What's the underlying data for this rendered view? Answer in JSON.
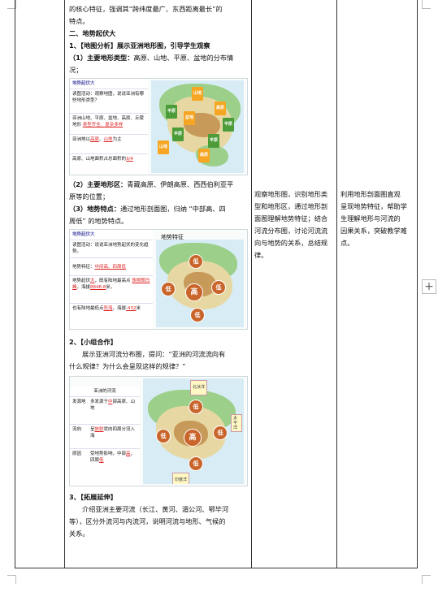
{
  "col2": {
    "l_intro1": "的核心特征，强调其“跨纬度最广、东西距离最长”的",
    "l_intro2": "特点。",
    "h2": "二、地势起伏大",
    "s1_title": "1、【地图分析】展示亚洲地形图，引导学生观察",
    "s1_sub1_b": "（1）主要地形类型：",
    "s1_sub1_t": "高原、山地、平原、盆地的分布情",
    "s1_sub1_t2": "况；",
    "fig1": {
      "head": "地势起伏大",
      "q": "读图活动：观察地图，说说亚洲有哪些地形类型？",
      "r1a": "亚洲山地、平原、盆地、高原、丘陵地形",
      "r1b": "类型齐全、复杂多样",
      "r2a": "亚洲地以",
      "r2b": "高原",
      "r2c": "、",
      "r2d": "山地",
      "r2e": "为主",
      "r3a": "高原、山地面积占总面积的",
      "r3b": "3/4",
      "tags": [
        "山地",
        "高原",
        "平原",
        "盆地",
        "平原",
        "平原",
        "平原",
        "山地",
        "高原"
      ]
    },
    "s1_sub2_b": "（2）主要地形区：",
    "s1_sub2_t": "青藏高原、伊朗高原、西西伯利亚平",
    "s1_sub2_t2": "原等的位置；",
    "s1_sub3_b": "（3）地势特点：",
    "s1_sub3_t": "通过地形剖面图，归纳 “中部高、四",
    "s1_sub3_t2": "周低” 的地势特点。",
    "fig2": {
      "head": "地势起伏大",
      "title": "地势特征",
      "q": "读图活动：说说亚洲地势起伏的变化趋势。",
      "r1a": "地势特征：",
      "r1b": "中间高、四周低",
      "r2a": "地势起伏",
      "r2b": "大",
      "r2c": "，既有陆地最高点",
      "r2d": "珠穆朗玛峰",
      "r2e": "，海拔",
      "r2f": "8848.8",
      "r2g": "米，",
      "r3a": "也有陆地最低点",
      "r3b": "死海",
      "r3c": "，海拔",
      "r3d": "-432",
      "r3e": "米",
      "circles": [
        "低",
        "低",
        "高",
        "低",
        "低"
      ]
    },
    "s2_title": "2、【小组合作】",
    "s2_t1": "展示亚洲河流分布图，提问：“亚洲的河流流向有",
    "s2_t2": "什么规律？为什么会呈现这样的规律？”",
    "fig3": {
      "top": "亚洲的河流",
      "k1": "发源地",
      "v1a": "多发源于",
      "v1b": "中",
      "v1c": "部高原、山地",
      "k2": "流向",
      "v2a": "呈",
      "v2b": "放射",
      "v2c": "状向四周分流入海",
      "k3": "原因",
      "v3a": "受地势影响，中部",
      "v3b": "高",
      "v3c": "，四周",
      "v3d": "低",
      "ocean1": "北冰洋",
      "ocean2": "太平洋",
      "ocean3": "印度洋",
      "circles": [
        "低",
        "低",
        "高",
        "低",
        "低"
      ]
    },
    "s3_title": "3、【拓展延伸】",
    "s3_t1": "介绍亚洲主要河流（长江、黄河、湄公河、鄂毕河",
    "s3_t2": "等），区分外流河与内流河，说明河流与地形、气候的",
    "s3_t3": "关系。"
  },
  "col3": [
    "观察地形图，识别地形类",
    "型和地形区，通过地形剖",
    "面图理解地势特征；结合",
    "河流分布图，讨论河流流",
    "向与地势的关系，总结规",
    "律。"
  ],
  "col4": [
    "利用地形剖面图直观",
    "呈现地势特征，帮助学",
    "生理解地形与河流的",
    "因果关系，突破教学难",
    "点。"
  ],
  "plus_label": "+"
}
